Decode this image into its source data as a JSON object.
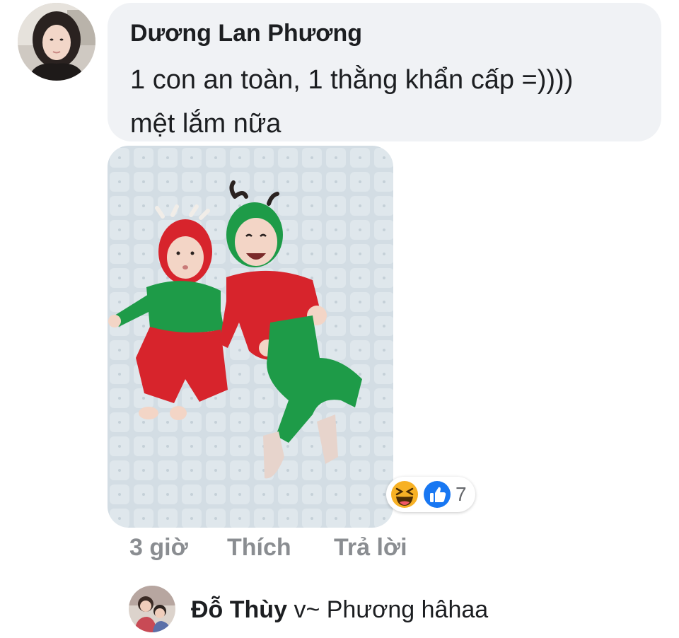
{
  "comment": {
    "author": "Dương Lan Phương",
    "text_line1": "1 con an toàn, 1 thằng khẩn cấp =))))",
    "text_line2": "mệt lắm nữa",
    "reactions": {
      "icons": [
        "haha-icon",
        "like-icon"
      ],
      "count": "7"
    },
    "timestamp": "3 giờ",
    "like_label": "Thích",
    "reply_label": "Trả lời"
  },
  "reply": {
    "author": "Đỗ Thùy",
    "text": "v~ Phương hâhaa"
  },
  "colors": {
    "bubble_bg": "#f0f2f5",
    "action_text": "#8a8d91",
    "like_blue": "#1877f2",
    "haha_yellow": "#f7b125"
  }
}
